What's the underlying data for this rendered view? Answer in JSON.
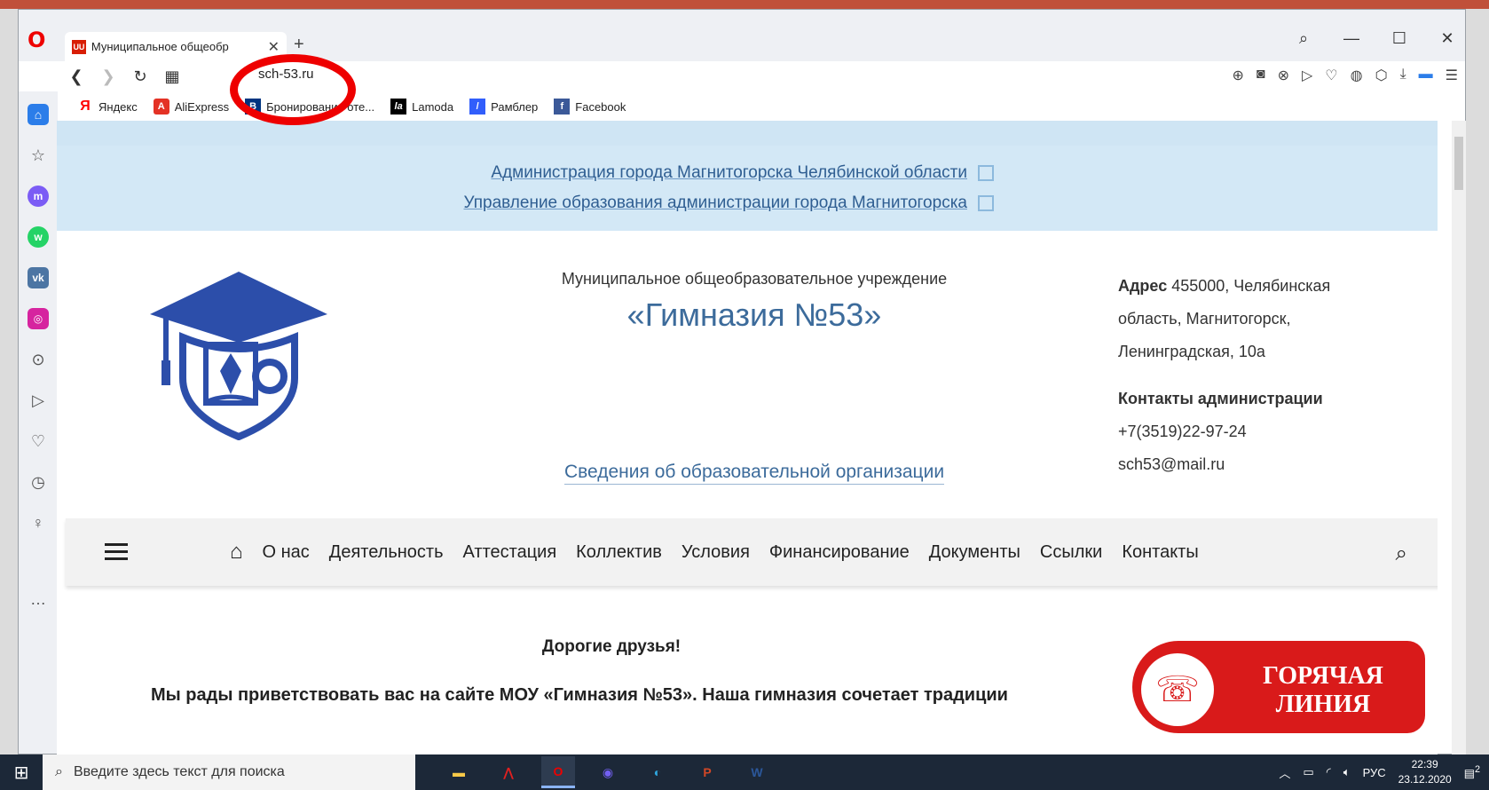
{
  "browser": {
    "tab_title": "Муниципальное общеобр",
    "tab_close": "✕",
    "new_tab": "+",
    "url": "sch-53.ru",
    "window_controls": {
      "search": "⌕",
      "minimize": "—",
      "maximize": "☐",
      "close": "✕"
    }
  },
  "bookmarks": [
    {
      "label": "Яндекс",
      "icon": "Я",
      "color": "#ff0000"
    },
    {
      "label": "AliExpress",
      "icon": "A",
      "color": "#e43225"
    },
    {
      "label": "Бронирование оте...",
      "icon": "B",
      "color": "#003580"
    },
    {
      "label": "Lamoda",
      "icon": "la",
      "color": "#000000"
    },
    {
      "label": "Рамблер",
      "icon": "/",
      "color": "#315efb"
    },
    {
      "label": "Facebook",
      "icon": "f",
      "color": "#3b5998"
    }
  ],
  "site": {
    "external_links": [
      "Администрация города Магнитогорска Челябинской области",
      "Управление образования администрации города Магнитогорска"
    ],
    "subtitle": "Муниципальное общеобразовательное учреждение",
    "title": "«Гимназия №53»",
    "info_link": "Сведения об образовательной организации",
    "address_label": "Адрес",
    "address_line1": "455000, Челябинская",
    "address_line2": "область, Магнитогорск,",
    "address_line3": "Ленинградская, 10а",
    "contacts_label": "Контакты администрации",
    "phone": "+7(3519)22-97-24",
    "email": "sch53@mail.ru",
    "menu": [
      "О нас",
      "Деятельность",
      "Аттестация",
      "Коллектив",
      "Условия",
      "Финансирование",
      "Документы",
      "Ссылки",
      "Контакты"
    ],
    "greeting": "Дорогие друзья!",
    "welcome": "Мы рады приветствовать вас на сайте МОУ «Гимназия №53». Наша гимназия сочетает традиции",
    "hotline_line1": "ГОРЯЧАЯ",
    "hotline_line2": "ЛИНИЯ"
  },
  "taskbar": {
    "search_placeholder": "Введите здесь текст для поиска",
    "language": "РУС",
    "time": "22:39",
    "date": "23.12.2020",
    "notifications": "2"
  },
  "colors": {
    "accent": "#3c6b9b",
    "band": "#d3e8f6",
    "hotline": "#d91a1a"
  }
}
